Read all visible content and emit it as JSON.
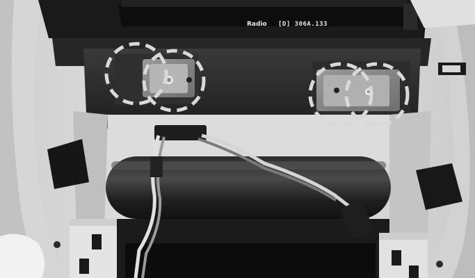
{
  "photo": {
    "subject": "car-dashboard-radio-cavity-grayscale",
    "head_unit": {
      "brand_text": "Radio",
      "model_text": "[D] 306A.133"
    },
    "markers": {
      "count": 4,
      "style": "dashed-circle",
      "color": "#d9d9d9"
    }
  }
}
